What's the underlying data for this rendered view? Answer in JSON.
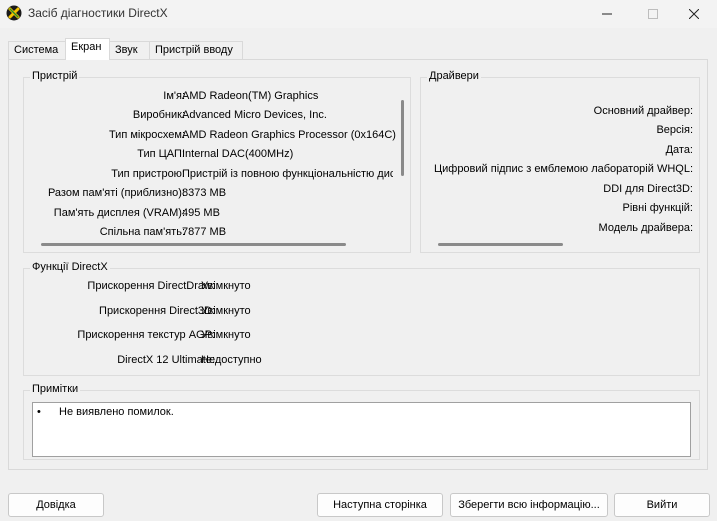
{
  "window": {
    "title": "Засіб діагностики DirectX",
    "icon": "directx-x-icon"
  },
  "tabs": [
    {
      "label": "Система"
    },
    {
      "label": "Екран"
    },
    {
      "label": "Звук"
    },
    {
      "label": "Пристрій вводу"
    }
  ],
  "device": {
    "title": "Пристрій",
    "rows": [
      {
        "label": "Ім'я:",
        "value": "AMD Radeon(TM) Graphics"
      },
      {
        "label": "Виробник:",
        "value": "Advanced Micro Devices, Inc."
      },
      {
        "label": "Тип мікросхем:",
        "value": "AMD Radeon Graphics Processor (0x164C)"
      },
      {
        "label": "Тип ЦАП:",
        "value": "Internal DAC(400MHz)"
      },
      {
        "label": "Тип пристрою:",
        "value": "Пристрій із повною функціональністю дисп"
      },
      {
        "label": "Разом пам'яті (приблизно):",
        "value": "8373 MB"
      },
      {
        "label": "Пам'ять дисплея (VRAM):",
        "value": "495 MB"
      },
      {
        "label": "Спільна пам'ять:",
        "value": "7877 MB"
      }
    ]
  },
  "drivers": {
    "title": "Драйвери",
    "rows": [
      {
        "label": "Основний драйвер:"
      },
      {
        "label": "Версія:"
      },
      {
        "label": "Дата:"
      },
      {
        "label": "Цифровий підпис з емблемою лабораторій WHQL:"
      },
      {
        "label": "DDI для Direct3D:"
      },
      {
        "label": "Рівні функцій:"
      },
      {
        "label": "Модель драйвера:"
      }
    ]
  },
  "features": {
    "title": "Функції DirectX",
    "rows": [
      {
        "label": "Прискорення DirectDraw:",
        "value": "Увімкнуто"
      },
      {
        "label": "Прискорення Direct3D:",
        "value": "Увімкнуто"
      },
      {
        "label": "Прискорення текстур AGP:",
        "value": "Увімкнуто"
      },
      {
        "label": "DirectX 12 Ultimate:",
        "value": "Недоступно"
      }
    ]
  },
  "notes": {
    "title": "Примітки",
    "items": [
      "Не виявлено помилок."
    ]
  },
  "buttons": {
    "help": "Довідка",
    "next_page": "Наступна сторінка",
    "save_all": "Зберегти всю інформацію...",
    "exit": "Вийти"
  }
}
